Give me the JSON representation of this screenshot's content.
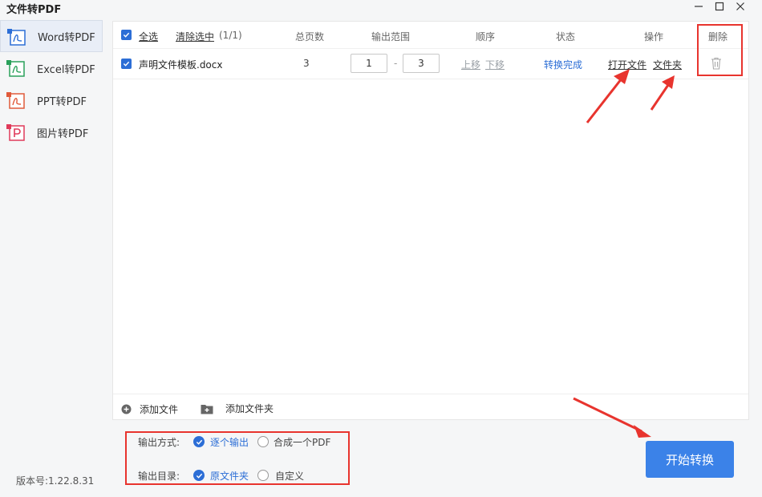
{
  "app": {
    "title": "文件转PDF"
  },
  "sidebar": {
    "items": [
      {
        "label": "Word转PDF",
        "icon": "word-to-pdf-icon",
        "color": "#2c6ed6",
        "active": true
      },
      {
        "label": "Excel转PDF",
        "icon": "excel-to-pdf-icon",
        "color": "#2aa05a",
        "active": false
      },
      {
        "label": "PPT转PDF",
        "icon": "ppt-to-pdf-icon",
        "color": "#e05a3a",
        "active": false
      },
      {
        "label": "图片转PDF",
        "icon": "image-to-pdf-icon",
        "color": "#e03a5a",
        "active": false
      }
    ],
    "version": "版本号:1.22.8.31"
  },
  "table": {
    "select_all": "全选",
    "clear_selected": "清除选中",
    "selected_count": "(1/1)",
    "headers": {
      "pages": "总页数",
      "range": "输出范围",
      "order": "顺序",
      "status": "状态",
      "actions": "操作",
      "delete": "删除"
    },
    "rows": [
      {
        "filename": "声明文件模板.docx",
        "pages": "3",
        "range_from": "1",
        "range_sep": "-",
        "range_to": "3",
        "move_up": "上移",
        "move_down": "下移",
        "status": "转换完成",
        "open_file": "打开文件",
        "open_folder": "文件夹"
      }
    ]
  },
  "footer": {
    "add_file": "添加文件",
    "add_folder": "添加文件夹"
  },
  "output": {
    "mode_label": "输出方式:",
    "mode_options": [
      "逐个输出",
      "合成一个PDF"
    ],
    "mode_selected": "逐个输出",
    "dir_label": "输出目录:",
    "dir_options": [
      "原文件夹",
      "自定义"
    ],
    "dir_selected": "原文件夹"
  },
  "start_button": "开始转换",
  "colors": {
    "accent": "#2c6ed6",
    "button": "#3b82e8",
    "annotation": "#e8342e"
  }
}
